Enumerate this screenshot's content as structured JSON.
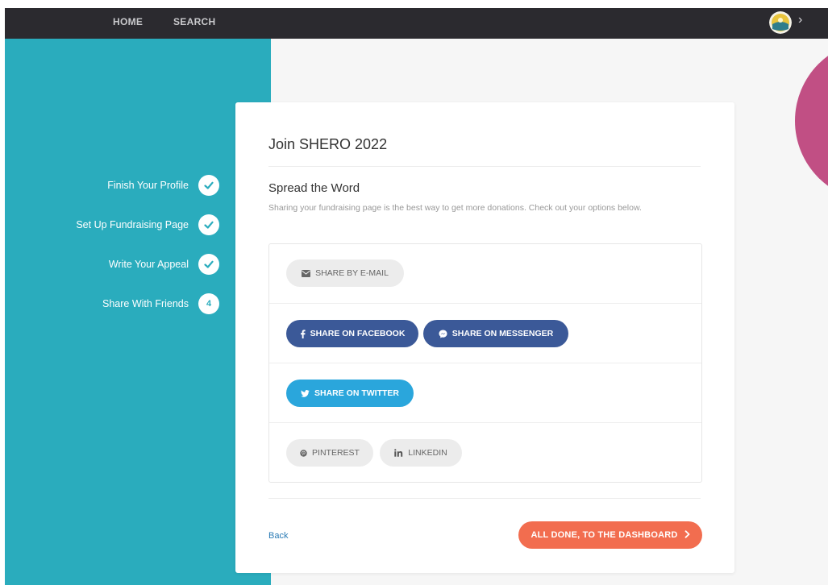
{
  "nav": {
    "home": "HOME",
    "search": "SEARCH"
  },
  "steps": [
    {
      "label": "Finish Your Profile",
      "status": "complete",
      "icon": "check-icon"
    },
    {
      "label": "Set Up Fundraising Page",
      "status": "complete",
      "icon": "check-icon"
    },
    {
      "label": "Write Your Appeal",
      "status": "complete",
      "icon": "check-icon"
    },
    {
      "label": "Share With Friends",
      "status": "current",
      "number": "4"
    }
  ],
  "card": {
    "title": "Join SHERO 2022",
    "section_title": "Spread the Word",
    "section_desc": "Sharing your fundraising page is the best way to get more donations. Check out your options below."
  },
  "share": {
    "email": "SHARE BY E-MAIL",
    "facebook": "SHARE ON FACEBOOK",
    "messenger": "SHARE ON MESSENGER",
    "twitter": "SHARE ON TWITTER",
    "pinterest": "PINTEREST",
    "linkedin": "LINKEDIN"
  },
  "footer": {
    "back": "Back",
    "done": "ALL DONE, TO THE DASHBOARD"
  },
  "colors": {
    "teal": "#2aacbd",
    "nav_bg": "#2b2a2f",
    "facebook": "#3b5998",
    "twitter": "#2aa6dc",
    "cta": "#f26d4f",
    "accent_pink": "#c14f84"
  },
  "icons": {
    "email": "envelope-icon",
    "facebook": "facebook-icon",
    "messenger": "messenger-icon",
    "twitter": "twitter-icon",
    "pinterest": "pinterest-icon",
    "linkedin": "linkedin-icon",
    "cta": "chevron-right-icon"
  }
}
